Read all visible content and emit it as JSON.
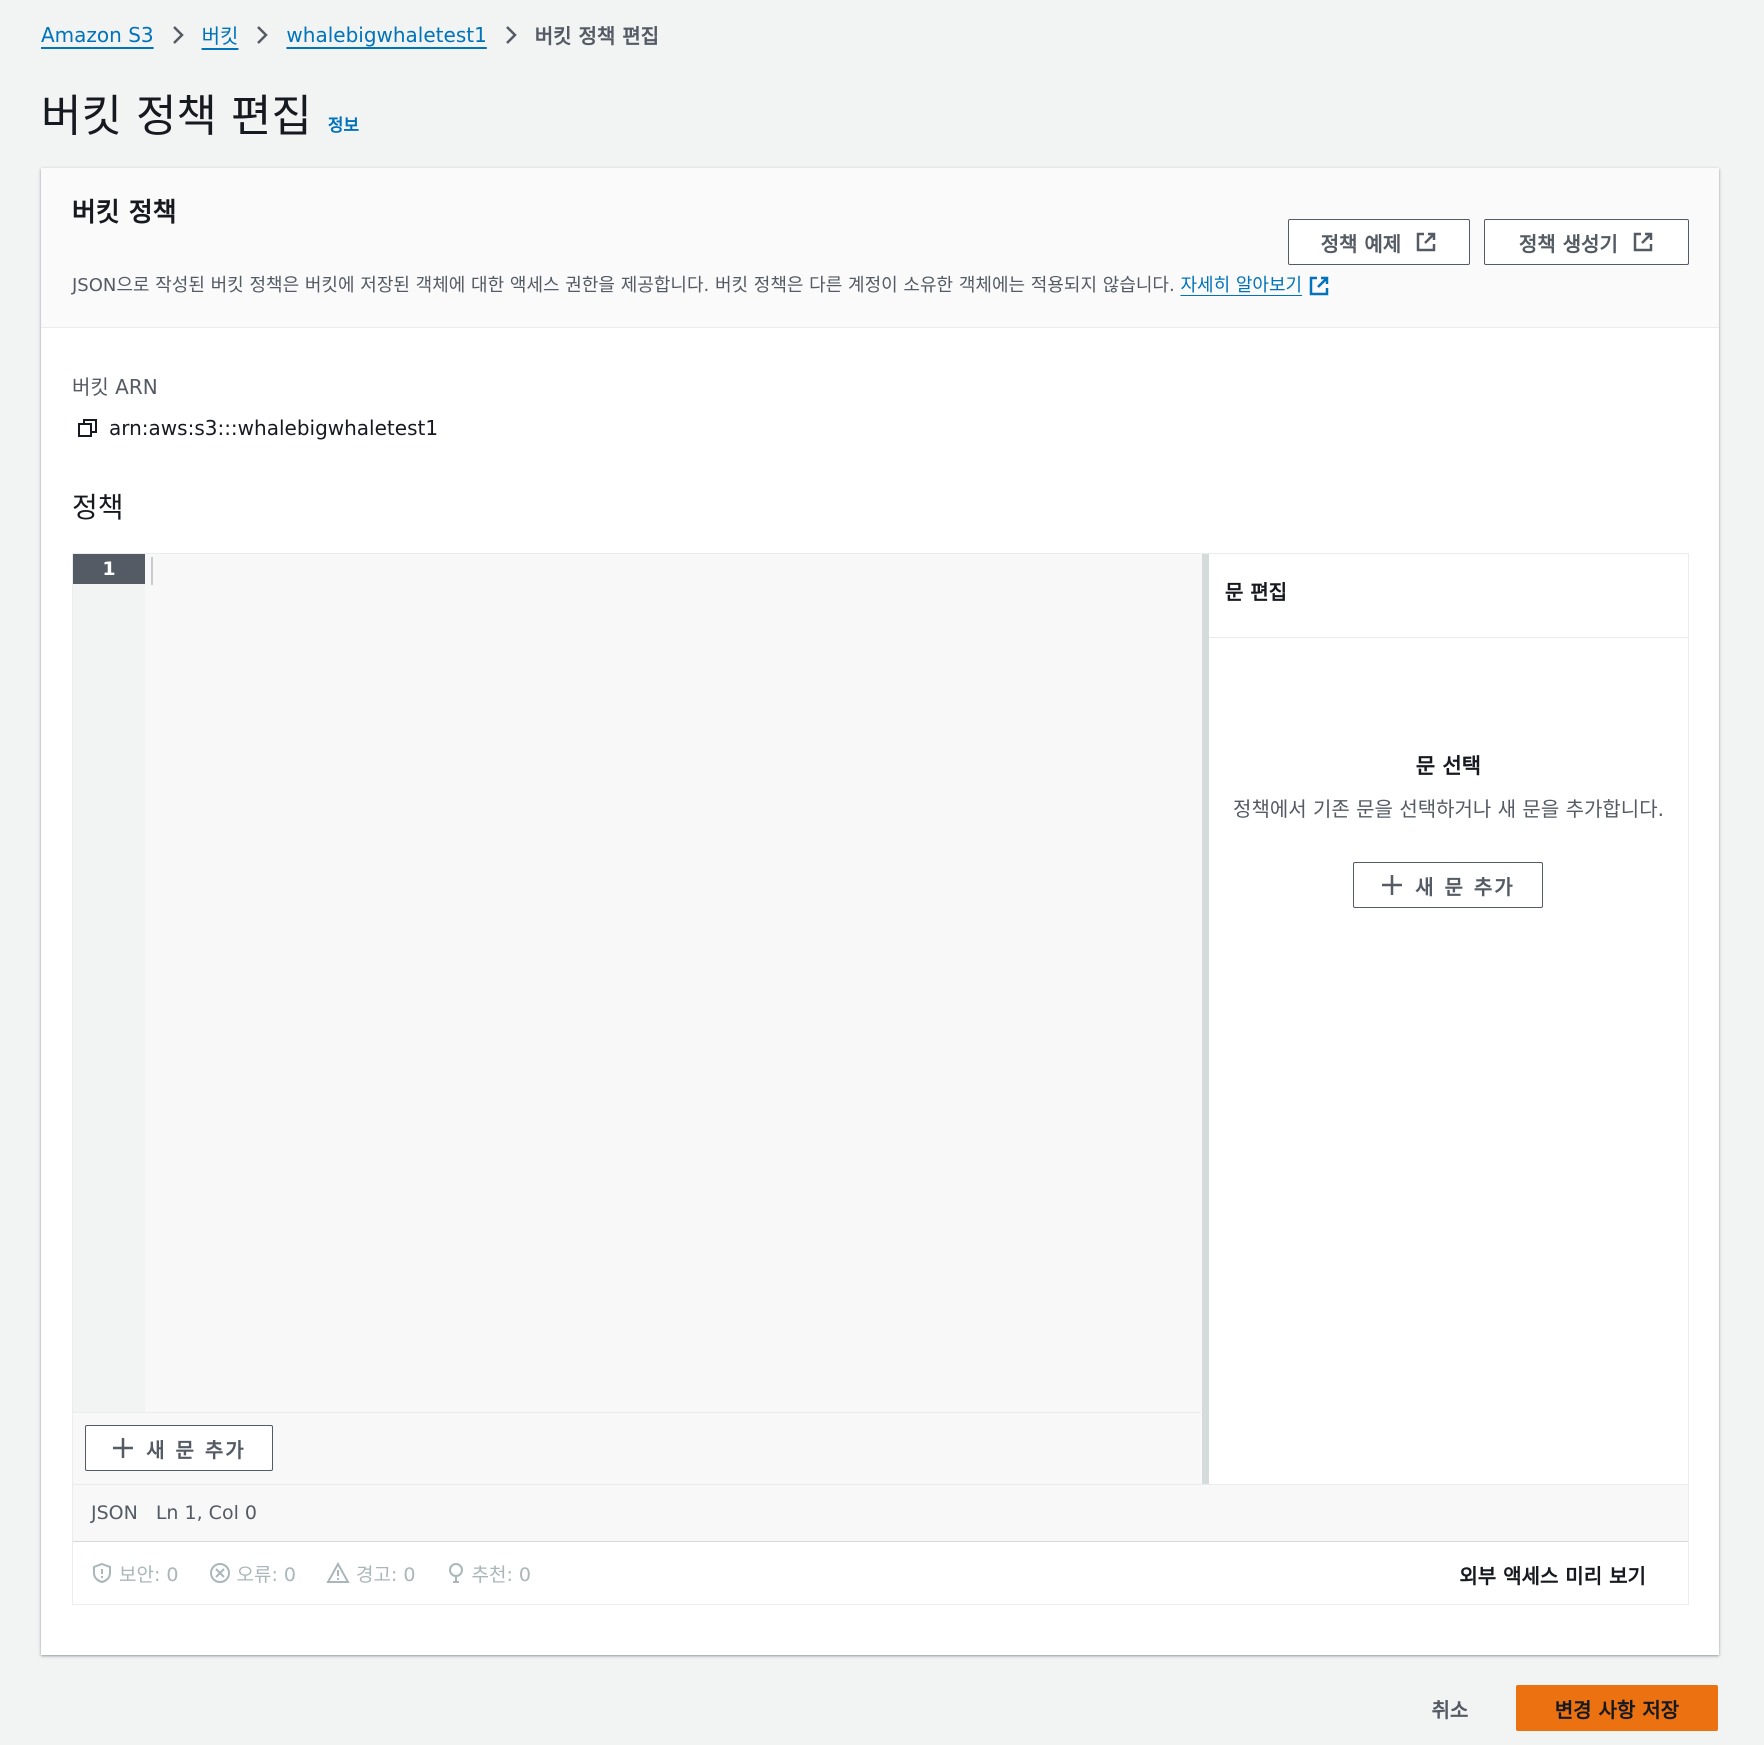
{
  "breadcrumb": {
    "items": [
      {
        "label": "Amazon S3"
      },
      {
        "label": "버킷"
      },
      {
        "label": "whalebigwhaletest1"
      }
    ],
    "current": "버킷 정책 편집"
  },
  "page": {
    "title": "버킷 정책 편집",
    "info_link": "정보"
  },
  "panel": {
    "title": "버킷 정책",
    "description": "JSON으로 작성된 버킷 정책은 버킷에 저장된 객체에 대한 액세스 권한을 제공합니다. 버킷 정책은 다른 계정이 소유한 객체에는 적용되지 않습니다.",
    "learn_more": "자세히 알아보기",
    "policy_examples_button": "정책 예제",
    "policy_generator_button": "정책 생성기",
    "arn_label": "버킷 ARN",
    "arn_value": "arn:aws:s3:::whalebigwhaletest1",
    "policy_label": "정책"
  },
  "editor": {
    "line_number": "1",
    "add_statement_button": "새 문 추가",
    "side_panel": {
      "title": "문 편집",
      "empty_title": "문 선택",
      "empty_description": "정책에서 기존 문을 선택하거나 새 문을 추가합니다.",
      "add_statement_button": "새 문 추가"
    },
    "status": {
      "language": "JSON",
      "position": "Ln 1, Col 0"
    },
    "checks": {
      "security": "보안: 0",
      "errors": "오류: 0",
      "warnings": "경고: 0",
      "suggestions": "추천: 0",
      "external_access_preview": "외부 액세스 미리 보기"
    }
  },
  "footer": {
    "cancel_button": "취소",
    "save_button": "변경 사항 저장"
  },
  "colors": {
    "link": "#0073bb",
    "primary_button": "#ec7211",
    "background": "#f2f3f3"
  }
}
